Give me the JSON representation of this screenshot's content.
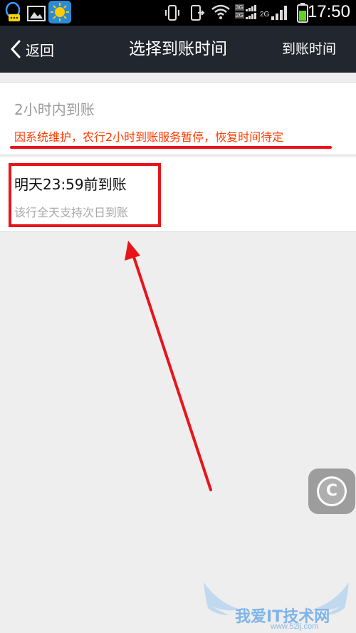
{
  "status_bar": {
    "time": "17:50",
    "network_labels": [
      "3G",
      "2G",
      "2G"
    ]
  },
  "nav": {
    "back_label": "返回",
    "title": "选择到账时间",
    "right_label": "到账时间"
  },
  "options": [
    {
      "title": "2小时内到账",
      "note": "因系统维护，农行2小时到账服务暂停，恢复时间待定",
      "enabled": false
    },
    {
      "title": "明天23:59前到账",
      "subtitle": "该行全天支持次日到账",
      "enabled": true
    }
  ],
  "float_button": {
    "glyph": "C"
  },
  "watermark": {
    "text": "我爱IT技术网",
    "url": "www.52ij.com"
  },
  "colors": {
    "nav_bg": "#22262e",
    "warning_text": "#ff3b00",
    "annotation_red": "#e8141a"
  }
}
